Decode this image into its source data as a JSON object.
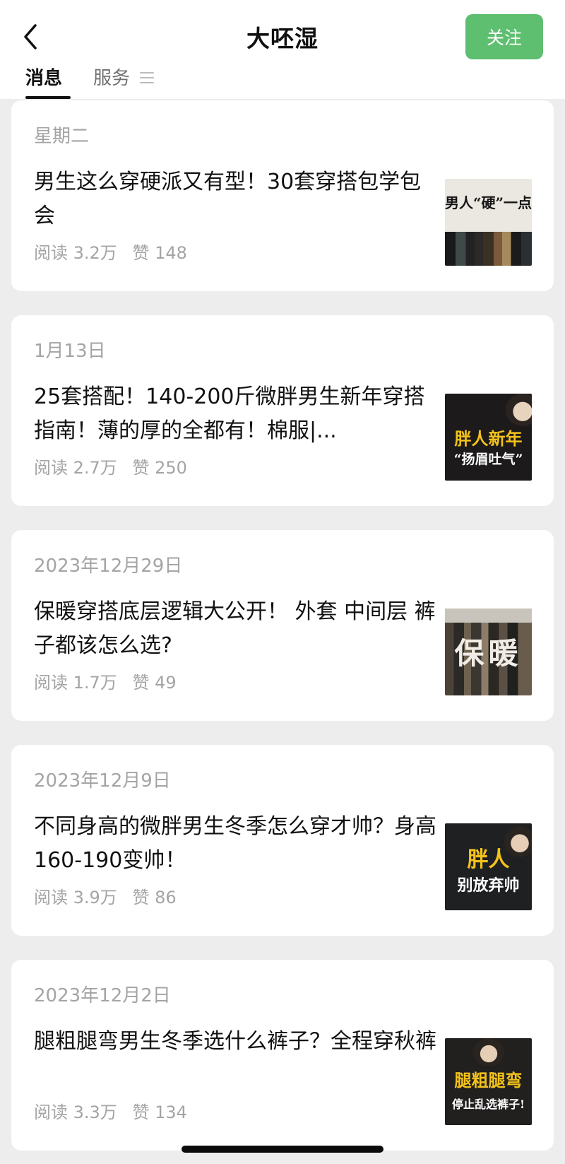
{
  "header": {
    "title": "大呸湿",
    "follow_label": "关注",
    "tabs": [
      {
        "label": "消息",
        "active": true
      },
      {
        "label": "服务",
        "active": false
      }
    ],
    "accent_color": "#5fbf70"
  },
  "articles": [
    {
      "date": "星期二",
      "title": "男生这么穿硬派又有型！30套穿搭包学包会",
      "reads": "阅读 3.2万",
      "likes": "赞 148",
      "thumb_text": [
        "男人“硬”一点"
      ]
    },
    {
      "date": "1月13日",
      "title": "25套搭配！140-200斤微胖男生新年穿搭指南！薄的厚的全都有！棉服|...",
      "reads": "阅读 2.7万",
      "likes": "赞 250",
      "thumb_text": [
        "胖人新年",
        "“扬眉吐气”"
      ]
    },
    {
      "date": "2023年12月29日",
      "title": "保暖穿搭底层逻辑大公开！ 外套 中间层 裤子都该怎么选?",
      "reads": "阅读 1.7万",
      "likes": "赞 49",
      "thumb_text": [
        "保暖"
      ]
    },
    {
      "date": "2023年12月9日",
      "title": "不同身高的微胖男生冬季怎么穿才帅？身高160-190变帅！",
      "reads": "阅读 3.9万",
      "likes": "赞 86",
      "thumb_text": [
        "胖人",
        "别放弃帅"
      ]
    },
    {
      "date": "2023年12月2日",
      "title": "腿粗腿弯男生冬季选什么裤子？全程穿秋裤",
      "reads": "阅读 3.3万",
      "likes": "赞 134",
      "thumb_text": [
        "腿粗腿弯",
        "停止乱选裤子!"
      ]
    }
  ]
}
